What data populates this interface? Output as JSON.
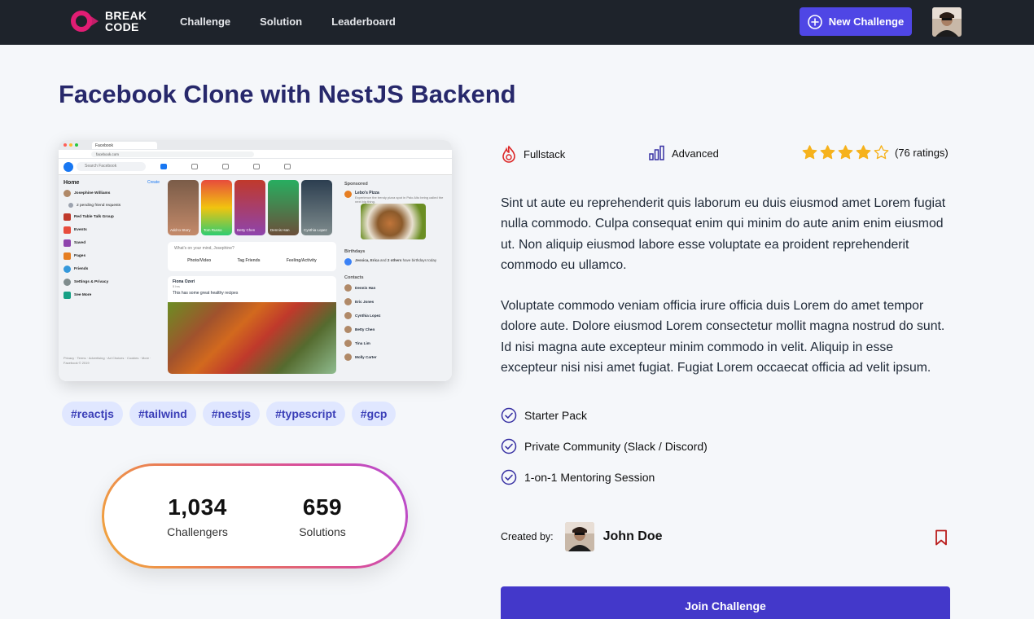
{
  "header": {
    "logo_line1": "BREAK",
    "logo_line2": "CODE",
    "nav": [
      "Challenge",
      "Solution",
      "Leaderboard"
    ],
    "new_challenge_label": "New Challenge"
  },
  "challenge": {
    "title": "Facebook Clone with NestJS Backend",
    "tags": [
      "#reactjs",
      "#tailwind",
      "#nestjs",
      "#typescript",
      "#gcp"
    ],
    "stats": [
      {
        "value": "1,034",
        "label": "Challengers"
      },
      {
        "value": "659",
        "label": "Solutions"
      }
    ],
    "category": "Fullstack",
    "level": "Advanced",
    "rating": {
      "stars": 4,
      "max": 5,
      "text": "(76 ratings)"
    },
    "description": [
      "Sint ut aute eu reprehenderit quis laborum eu duis eiusmod amet Lorem fugiat nulla commodo. Culpa consequat enim qui minim do aute anim enim eiusmod ut. Non aliquip eiusmod labore esse voluptate ea proident reprehenderit commodo eu ullamco.",
      "Voluptate commodo veniam officia irure officia duis Lorem do amet tempor dolore aute. Dolore eiusmod Lorem consectetur mollit magna nostrud do sunt. Id nisi magna aute excepteur minim commodo in velit. Aliquip in esse excepteur nisi nisi amet fugiat. Fugiat Lorem occaecat officia ad velit ipsum."
    ],
    "features": [
      "Starter Pack",
      "Private Community (Slack / Discord)",
      "1-on-1 Mentoring Session"
    ],
    "created_by_label": "Created by:",
    "creator_name": "John Doe",
    "join_label": "Join Challenge"
  },
  "preview": {
    "tab_title": "Facebook",
    "url": "facebook.com",
    "search_placeholder": "Search Facebook",
    "left_title": "Home",
    "left_create": "Create",
    "left_user": "Josephine Williams",
    "left_sub": "2 pending friend requests",
    "left_items": [
      "Red Table Talk Group",
      "Events",
      "Saved",
      "Pages",
      "Friends",
      "Settings & Privacy",
      "See More"
    ],
    "stories": [
      "Add to Story",
      "Tom Russo",
      "Betty Chen",
      "Dennis Han",
      "Cynthia Lopez"
    ],
    "compose_placeholder": "What's on your mind, Josephine?",
    "compose_actions": [
      "Photo/Video",
      "Tag Friends",
      "Feeling/Activity"
    ],
    "post_author": "Fiona Ozeri",
    "post_time": "5 hrs",
    "post_text": "This has some great healthy recipes",
    "sponsored": "Sponsored",
    "ad_name": "Lebo's Pizza",
    "ad_text": "Experience the trendy pizza spot in Palo Alto being called the next big thing.",
    "birthdays": "Birthdays",
    "birthday_text_bold": "Jessica, Erica",
    "birthday_text_and": "and",
    "birthday_text_others": "2 others",
    "birthday_text_rest": "have birthdays today",
    "contacts": "Contacts",
    "contacts_list": [
      "Dennis Han",
      "Eric Jones",
      "Cynthia Lopez",
      "Betty Chen",
      "Tina Lim",
      "Molly Carter"
    ],
    "footer": "Privacy · Terms · Advertising · Ad Choices · Cookies · More · Facebook © 2019"
  },
  "colors": {
    "header_bg": "#1e232b",
    "accent": "#4f46e5",
    "title": "#27286b",
    "tag_bg": "#e0e7ff",
    "tag_text": "#3b3fb8",
    "star": "#f6b21c",
    "bookmark": "#b91c1c"
  }
}
